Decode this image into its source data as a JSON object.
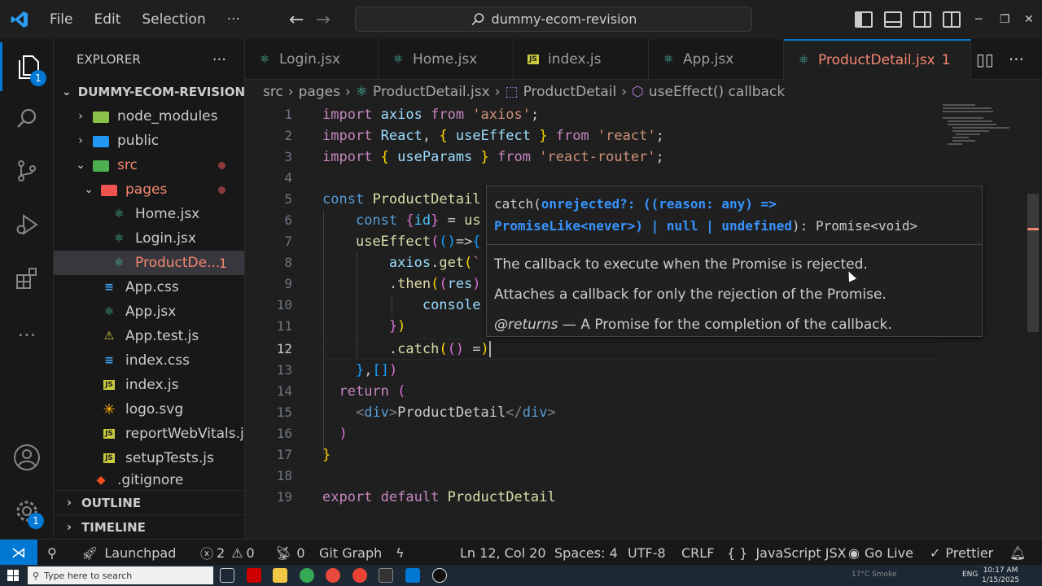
{
  "menu": {
    "file": "File",
    "edit": "Edit",
    "selection": "Selection",
    "more": "···"
  },
  "command_center": {
    "text": "dummy-ecom-revision"
  },
  "activity": {
    "explorer_badge": "1",
    "settings_badge": "1"
  },
  "explorer": {
    "title": "EXPLORER",
    "more": "···",
    "root": "DUMMY-ECOM-REVISION",
    "items": [
      {
        "label": "node_modules"
      },
      {
        "label": "public"
      },
      {
        "label": "src"
      },
      {
        "label": "pages"
      },
      {
        "label": "Home.jsx"
      },
      {
        "label": "Login.jsx"
      },
      {
        "label": "ProductDe...",
        "errors": "1"
      },
      {
        "label": "App.css"
      },
      {
        "label": "App.jsx"
      },
      {
        "label": "App.test.js"
      },
      {
        "label": "index.css"
      },
      {
        "label": "index.js"
      },
      {
        "label": "logo.svg"
      },
      {
        "label": "reportWebVitals.js"
      },
      {
        "label": "setupTests.js"
      },
      {
        "label": ".gitignore"
      }
    ],
    "outline": "OUTLINE",
    "timeline": "TIMELINE"
  },
  "tabs": [
    {
      "label": "Login.jsx"
    },
    {
      "label": "Home.jsx"
    },
    {
      "label": "index.js"
    },
    {
      "label": "App.jsx"
    },
    {
      "label": "ProductDetail.jsx",
      "errors": "1"
    }
  ],
  "breadcrumb": {
    "p1": "src",
    "p2": "pages",
    "p3": "ProductDetail.jsx",
    "p4": "ProductDetail",
    "p5": "useEffect() callback"
  },
  "editor": {
    "line_numbers": [
      "1",
      "2",
      "3",
      "4",
      "5",
      "6",
      "7",
      "8",
      "9",
      "10",
      "11",
      "12",
      "13",
      "14",
      "15",
      "16",
      "17",
      "18",
      "19"
    ],
    "current_line": 12
  },
  "hover": {
    "sig1_name": "catch(",
    "sig1_param": "onrejected?: ((reason: any) =>",
    "sig2_type": "PromiseLike<never>) | null | undefined",
    "sig2_rest": "): Promise<void>",
    "doc1": "The callback to execute when the Promise is rejected.",
    "doc2": "Attaches a callback for only the rejection of the Promise.",
    "returns_tag": "@returns",
    "returns_text": " — A Promise for the completion of the callback."
  },
  "status": {
    "launchpad": "Launchpad",
    "errors": "2",
    "warnings": "0",
    "ports": "0",
    "git_graph": "Git Graph",
    "position": "Ln 12, Col 20",
    "spaces": "Spaces: 4",
    "encoding": "UTF-8",
    "eol": "CRLF",
    "language": "JavaScript JSX",
    "go_live": "Go Live",
    "prettier": "Prettier"
  },
  "taskbar": {
    "search_placeholder": "Type here to search",
    "weather": "17°C Smoke",
    "lang": "ENG",
    "time": "10:17 AM",
    "date": "1/15/2025"
  },
  "colors": {
    "accent": "#0078d4",
    "error": "#f48771",
    "react_icon": "#4ec9b0",
    "js_icon": "#cbcb41"
  }
}
